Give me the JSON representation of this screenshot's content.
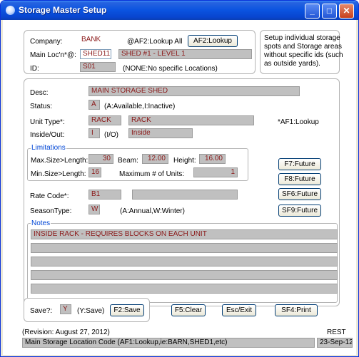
{
  "window": {
    "title": "Storage Master Setup",
    "min_glyph": "_",
    "max_glyph": "□",
    "close_glyph": "✕"
  },
  "top": {
    "company_label": "Company:",
    "company_value": "BANK",
    "lookup_all_text": "@AF2:Lookup All",
    "af2_button": "AF2:Lookup",
    "main_loc_label": "Main Loc'n*@:",
    "main_loc_value": "SHED11",
    "main_loc_desc": "SHED #1 - LEVEL 1",
    "id_label": "ID:",
    "id_value": "S01",
    "id_hint": "(NONE:No specific Locations)",
    "help_text_lines": [
      "Setup individual storage",
      "spots and Storage areas",
      "without specific ids (such",
      "as outside yards)."
    ]
  },
  "detail": {
    "desc_label": "Desc:",
    "desc_value": "MAIN STORAGE SHED",
    "status_label": "Status:",
    "status_value": "A",
    "status_hint": "(A:Available,I:Inactive)",
    "unit_type_label": "Unit Type*:",
    "unit_type_code": "RACK",
    "unit_type_desc": "RACK",
    "af1_hint": "*AF1:Lookup",
    "inside_label": "Inside/Out:",
    "inside_code": "I",
    "inside_hint": "(I/O)",
    "inside_desc": "Inside"
  },
  "limitations": {
    "legend": "Limitations",
    "max_size_label": "Max.Size>Length:",
    "max_size_value": "30",
    "beam_label": "Beam:",
    "beam_value": "12.00",
    "height_label": "Height:",
    "height_value": "16.00",
    "min_size_label": "Min.Size>Length:",
    "min_size_value": "16",
    "max_units_label": "Maximum # of Units:",
    "max_units_value": "1"
  },
  "future_buttons": [
    "F7:Future",
    "F8:Future",
    "SF6:Future",
    "SF9:Future"
  ],
  "rate": {
    "rate_label": "Rate Code*:",
    "rate_value": "B1",
    "rate_desc": "",
    "season_label": "SeasonType:",
    "season_value": "W",
    "season_hint": "(A:Annual,W:Winter)"
  },
  "notes": {
    "legend": "Notes",
    "lines": [
      "INSIDE RACK - REQUIRES BLOCKS ON EACH UNIT",
      "",
      "",
      "",
      ""
    ]
  },
  "bottom": {
    "save_label": "Save?:",
    "save_value": "Y",
    "save_hint": "(Y:Save)",
    "f2_button": "F2:Save",
    "f5_button": "F5:Clear",
    "esc_button": "Esc/Exit",
    "sf4_button": "SF4:Print"
  },
  "status_bar": {
    "revision": "(Revision: August 27, 2012)",
    "mode": "REST",
    "hint": "Main Storage Location Code (AF1:Lookup,ie:BARN,SHED1,etc)",
    "date": "23-Sep-12"
  }
}
